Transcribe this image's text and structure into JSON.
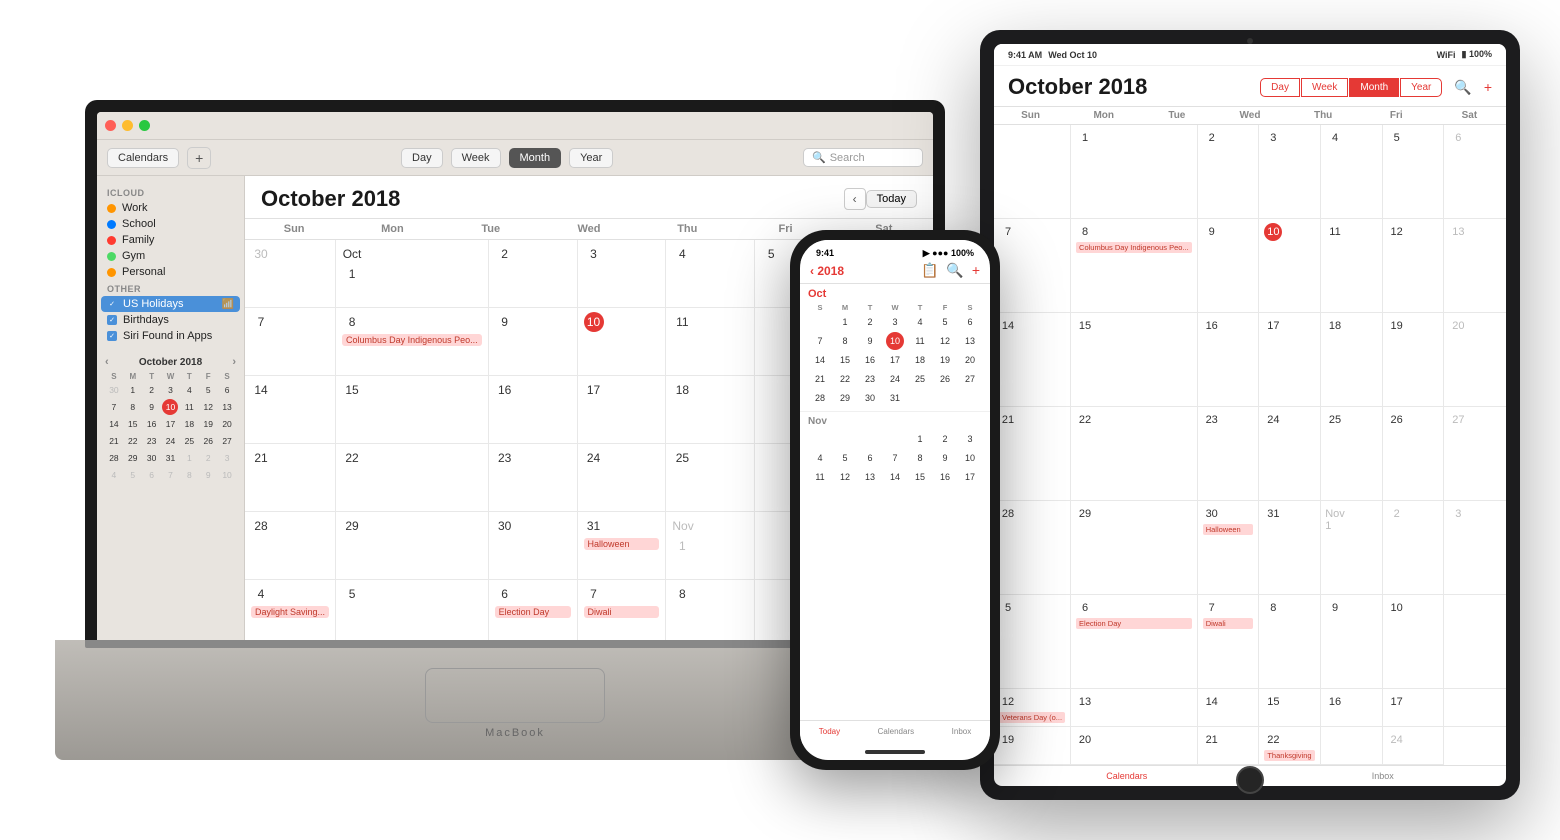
{
  "scene": {
    "bg": "#ffffff"
  },
  "macbook": {
    "title": "MacBook",
    "titlebar": {
      "dots": [
        "red",
        "yellow",
        "green"
      ]
    },
    "toolbar": {
      "calendars_btn": "Calendars",
      "plus_btn": "+",
      "day_btn": "Day",
      "week_btn": "Week",
      "month_btn": "Month",
      "year_btn": "Year",
      "search_placeholder": "Search"
    },
    "sidebar": {
      "icloud_label": "iCloud",
      "items": [
        {
          "label": "Work",
          "color": "#FF9500"
        },
        {
          "label": "School",
          "color": "#007AFF"
        },
        {
          "label": "Family",
          "color": "#FF3B30"
        },
        {
          "label": "Gym",
          "color": "#4CD964"
        },
        {
          "label": "Personal",
          "color": "#FF9500"
        }
      ],
      "other_label": "Other",
      "other_items": [
        {
          "label": "US Holidays",
          "color": "#007AFF",
          "checked": true,
          "selected": true
        },
        {
          "label": "Birthdays",
          "color": "#007AFF",
          "checked": true
        },
        {
          "label": "Siri Found in Apps",
          "color": "#007AFF",
          "checked": true
        }
      ],
      "mini_cal": {
        "title": "October 2018",
        "days_header": [
          "S",
          "M",
          "T",
          "W",
          "T",
          "F",
          "S"
        ],
        "weeks": [
          [
            "30",
            "1",
            "2",
            "3",
            "4",
            "5",
            "6"
          ],
          [
            "7",
            "8",
            "9",
            "10",
            "11",
            "12",
            "13"
          ],
          [
            "14",
            "15",
            "16",
            "17",
            "18",
            "19",
            "20"
          ],
          [
            "21",
            "22",
            "23",
            "24",
            "25",
            "26",
            "27"
          ],
          [
            "28",
            "29",
            "30",
            "31",
            "1",
            "2",
            "3"
          ],
          [
            "4",
            "5",
            "6",
            "7",
            "8",
            "9",
            "10"
          ]
        ],
        "today": "10",
        "other_month": [
          "30",
          "1",
          "2",
          "3",
          "4",
          "5",
          "6",
          "1",
          "2",
          "3",
          "4",
          "5",
          "6",
          "7",
          "8",
          "9",
          "10"
        ]
      }
    },
    "calendar": {
      "title": "October 2018",
      "days_header": [
        "Sun",
        "Mon",
        "Tue",
        "Wed",
        "Thu",
        "Fri",
        "Sat"
      ],
      "today_btn": "Today",
      "cells": [
        {
          "num": "30",
          "other": true,
          "events": []
        },
        {
          "num": "Oct 1",
          "events": []
        },
        {
          "num": "2",
          "events": []
        },
        {
          "num": "3",
          "events": []
        },
        {
          "num": "4",
          "events": []
        },
        {
          "num": "5",
          "events": []
        },
        {
          "num": "",
          "events": []
        },
        {
          "num": "7",
          "events": []
        },
        {
          "num": "8",
          "events": [
            {
              "label": "Columbus Day Indigenous Peo...",
              "class": "event-pink"
            }
          ]
        },
        {
          "num": "9",
          "events": []
        },
        {
          "num": "10",
          "today": true,
          "events": []
        },
        {
          "num": "11",
          "events": []
        },
        {
          "num": "",
          "events": []
        },
        {
          "num": "",
          "events": []
        },
        {
          "num": "14",
          "events": []
        },
        {
          "num": "15",
          "events": []
        },
        {
          "num": "16",
          "events": []
        },
        {
          "num": "17",
          "events": []
        },
        {
          "num": "18",
          "events": []
        },
        {
          "num": "",
          "events": []
        },
        {
          "num": "",
          "events": []
        },
        {
          "num": "21",
          "events": []
        },
        {
          "num": "22",
          "events": []
        },
        {
          "num": "23",
          "events": []
        },
        {
          "num": "24",
          "events": []
        },
        {
          "num": "25",
          "events": []
        },
        {
          "num": "",
          "events": []
        },
        {
          "num": "",
          "events": []
        },
        {
          "num": "28",
          "events": []
        },
        {
          "num": "29",
          "events": []
        },
        {
          "num": "30",
          "events": []
        },
        {
          "num": "31",
          "events": [
            {
              "label": "Halloween",
              "class": "event-pink"
            }
          ]
        },
        {
          "num": "Nov 1",
          "other": true,
          "events": []
        },
        {
          "num": "",
          "events": []
        },
        {
          "num": "",
          "events": []
        },
        {
          "num": "4",
          "events": [
            {
              "label": "Daylight Saving...",
              "class": "event-pink"
            }
          ]
        },
        {
          "num": "5",
          "events": []
        },
        {
          "num": "6",
          "events": [
            {
              "label": "Election Day",
              "class": "event-pink"
            }
          ]
        },
        {
          "num": "7",
          "events": [
            {
              "label": "Diwali",
              "class": "event-pink"
            }
          ]
        },
        {
          "num": "8",
          "events": []
        },
        {
          "num": "",
          "events": []
        },
        {
          "num": "",
          "events": []
        }
      ]
    }
  },
  "iphone": {
    "statusbar": {
      "time": "9:41",
      "signal": "●●●",
      "wifi": "WiFi",
      "battery": "100%"
    },
    "header": {
      "year": "‹ 2018",
      "icons": [
        "📷",
        "🔍",
        "+"
      ]
    },
    "oct_label": "Oct",
    "days_header": [
      "S",
      "M",
      "T",
      "W",
      "T",
      "F",
      "S"
    ],
    "oct_weeks": [
      [
        "",
        "1",
        "2",
        "3",
        "4",
        "5",
        "6"
      ],
      [
        "7",
        "8",
        "9",
        "10",
        "11",
        "12",
        "13"
      ],
      [
        "14",
        "15",
        "16",
        "17",
        "18",
        "19",
        "20"
      ],
      [
        "21",
        "22",
        "23",
        "24",
        "25",
        "26",
        "27"
      ],
      [
        "28",
        "29",
        "30",
        "31",
        "",
        "",
        ""
      ]
    ],
    "today": "10",
    "nov_label": "Nov",
    "nov_weeks": [
      [
        "",
        "",
        "",
        "",
        "1",
        "2",
        "3"
      ],
      [
        "4",
        "5",
        "6",
        "7",
        "8",
        "9",
        "10"
      ],
      [
        "11",
        "12",
        "13",
        "14",
        "15",
        "16",
        "17"
      ]
    ],
    "bottom_tabs": [
      {
        "label": "Today",
        "active": true
      },
      {
        "label": "Calendars",
        "active": false
      },
      {
        "label": "Inbox",
        "active": false
      }
    ]
  },
  "ipad": {
    "statusbar": {
      "time": "9:41 AM",
      "date": "Wed Oct 10",
      "wifi": "WiFi",
      "battery": "100%"
    },
    "header": {
      "title": "October 2018",
      "view_btns": [
        "Day",
        "Week",
        "Month",
        "Year"
      ],
      "active_view": "Month"
    },
    "days_header": [
      "Sun",
      "Mon",
      "Tue",
      "Wed",
      "Thu",
      "Fri",
      "Sat"
    ],
    "cells": [
      {
        "num": "",
        "events": []
      },
      {
        "num": "1",
        "events": []
      },
      {
        "num": "2",
        "events": []
      },
      {
        "num": "3",
        "events": []
      },
      {
        "num": "4",
        "events": []
      },
      {
        "num": "5",
        "events": []
      },
      {
        "num": "6",
        "other": true,
        "events": []
      },
      {
        "num": "7",
        "events": []
      },
      {
        "num": "8",
        "events": [
          {
            "label": "Columbus Day Indigenous Peo...",
            "class": "ipad-event-pink"
          }
        ]
      },
      {
        "num": "9",
        "events": []
      },
      {
        "num": "10",
        "today": true,
        "events": []
      },
      {
        "num": "11",
        "events": []
      },
      {
        "num": "12",
        "events": []
      },
      {
        "num": "13",
        "other": true,
        "events": []
      },
      {
        "num": "14",
        "events": []
      },
      {
        "num": "15",
        "events": []
      },
      {
        "num": "16",
        "events": []
      },
      {
        "num": "17",
        "events": []
      },
      {
        "num": "18",
        "events": []
      },
      {
        "num": "19",
        "events": []
      },
      {
        "num": "20",
        "other": true,
        "events": []
      },
      {
        "num": "21",
        "events": []
      },
      {
        "num": "22",
        "events": []
      },
      {
        "num": "23",
        "events": []
      },
      {
        "num": "24",
        "events": []
      },
      {
        "num": "25",
        "events": []
      },
      {
        "num": "26",
        "events": []
      },
      {
        "num": "27",
        "other": true,
        "events": []
      },
      {
        "num": "28",
        "events": []
      },
      {
        "num": "29",
        "events": []
      },
      {
        "num": "30",
        "events": [
          {
            "label": "Halloween",
            "class": "ipad-event-pink"
          }
        ]
      },
      {
        "num": "31",
        "events": []
      },
      {
        "num": "Nov 1",
        "events": []
      },
      {
        "num": "2",
        "events": []
      },
      {
        "num": "3",
        "other": true,
        "events": []
      },
      {
        "num": "5",
        "events": []
      },
      {
        "num": "6",
        "events": [
          {
            "label": "Election Day",
            "class": "ipad-event-pink"
          }
        ]
      },
      {
        "num": "7",
        "events": [
          {
            "label": "Diwali",
            "class": "ipad-event-pink"
          }
        ]
      },
      {
        "num": "8",
        "events": []
      },
      {
        "num": "9",
        "events": []
      },
      {
        "num": "10",
        "events": []
      },
      {
        "num": "",
        "other": true,
        "events": []
      },
      {
        "num": "12",
        "events": [
          {
            "label": "Veterans Day (o...",
            "class": "ipad-event-pink"
          }
        ]
      },
      {
        "num": "13",
        "events": []
      },
      {
        "num": "14",
        "events": []
      },
      {
        "num": "15",
        "events": []
      },
      {
        "num": "16",
        "events": []
      },
      {
        "num": "17",
        "events": []
      },
      {
        "num": "",
        "other": true,
        "events": []
      },
      {
        "num": "19",
        "events": []
      },
      {
        "num": "20",
        "events": []
      },
      {
        "num": "21",
        "events": []
      },
      {
        "num": "22",
        "events": [
          {
            "label": "Thanksgiving",
            "class": "ipad-event-pink"
          }
        ]
      },
      {
        "num": "",
        "events": []
      },
      {
        "num": "24",
        "other": true,
        "events": []
      }
    ],
    "bottom_tabs": [
      {
        "label": "Calendars",
        "active": false
      },
      {
        "label": "Inbox",
        "active": false
      }
    ]
  }
}
